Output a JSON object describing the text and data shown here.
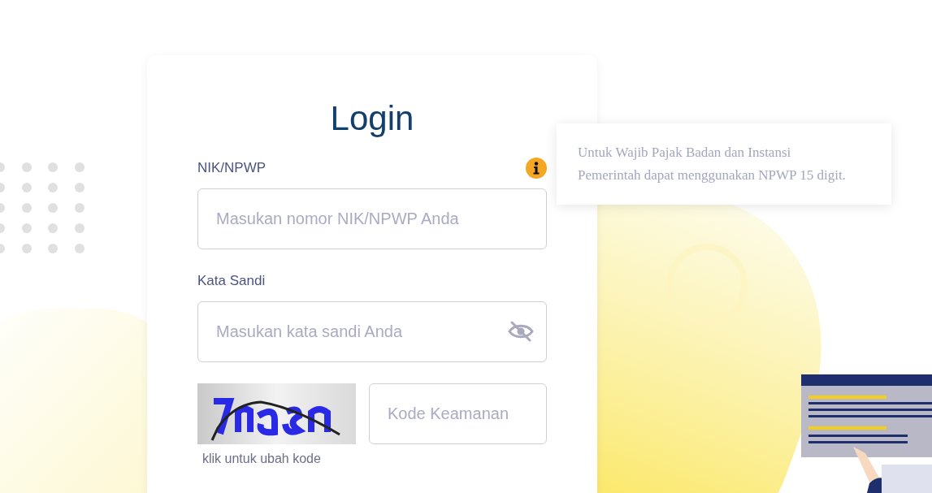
{
  "login": {
    "title": "Login",
    "fields": [
      {
        "kind": "text",
        "label": "NIK/NPWP",
        "placeholder": "Masukan nomor NIK/NPWP Anda",
        "info": true
      },
      {
        "kind": "password",
        "label": "Kata Sandi",
        "placeholder": "Masukan kata sandi Anda",
        "password_hidden": true
      }
    ],
    "captcha": {
      "placeholder": "Kode Keamanan",
      "refresh_link": "klik untuk ubah kode"
    }
  },
  "tooltip": {
    "text": "Untuk Wajib Pajak Badan dan Instansi Pemerintah dapat menggunakan NPWP 15 digit."
  }
}
